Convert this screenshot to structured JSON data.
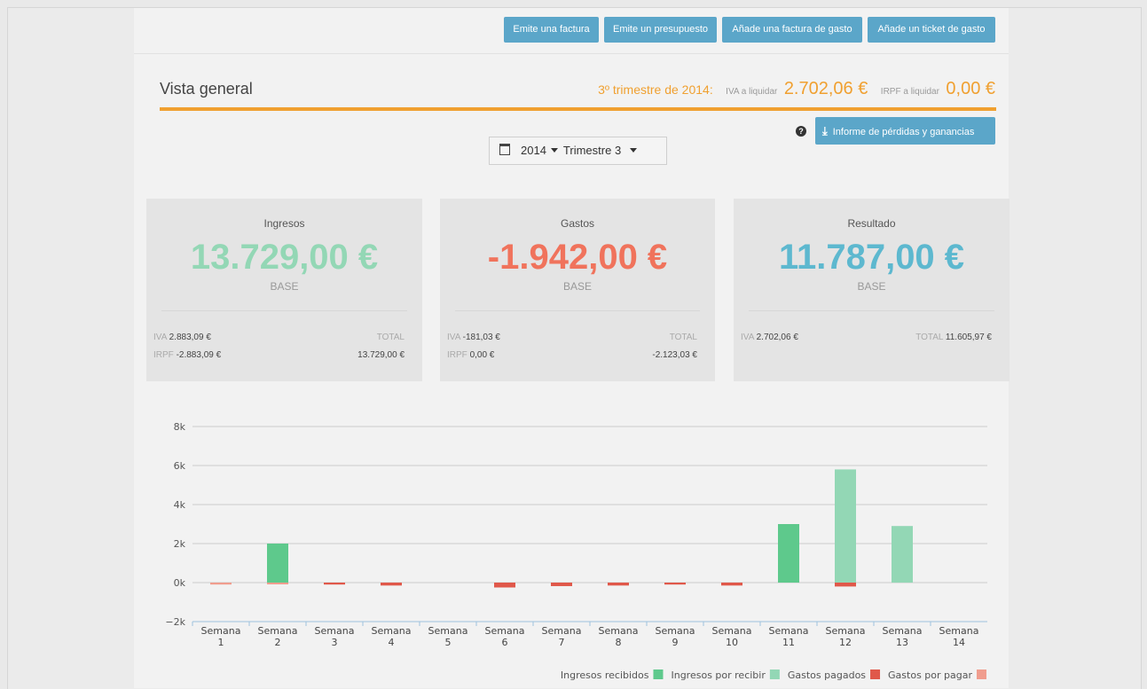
{
  "toolbar": {
    "buttons": [
      {
        "label": "Emite una factura"
      },
      {
        "label": "Emite un presupuesto"
      },
      {
        "label": "Añade una factura de gasto"
      },
      {
        "label": "Añade un ticket de gasto"
      }
    ]
  },
  "header": {
    "title": "Vista general",
    "quarter_text": "3º trimestre de 2014:",
    "iva_label": "IVA a liquidar",
    "iva_value": "2.702,06 €",
    "irpf_label": "IRPF a liquidar",
    "irpf_value": "0,00 €"
  },
  "report_button": {
    "label": "Informe de pérdidas y ganancias",
    "icon": "download-icon"
  },
  "help_icon": "?",
  "period_selector": {
    "year": "2014",
    "quarter": "Trimestre 3"
  },
  "cards": {
    "ingresos": {
      "label": "Ingresos",
      "amount": "13.729,00 €",
      "base": "BASE",
      "iva_key": "IVA",
      "iva": "2.883,09 €",
      "irpf_key": "IRPF",
      "irpf": "-2.883,09 €",
      "total_key": "TOTAL",
      "total": "13.729,00 €"
    },
    "gastos": {
      "label": "Gastos",
      "amount": "-1.942,00 €",
      "base": "BASE",
      "iva_key": "IVA",
      "iva": "-181,03 €",
      "irpf_key": "IRPF",
      "irpf": "0,00 €",
      "total_key": "TOTAL",
      "total": "-2.123,03 €"
    },
    "resultado": {
      "label": "Resultado",
      "amount": "11.787,00 €",
      "base": "BASE",
      "iva_key": "IVA",
      "iva": "2.702,06 €",
      "total_key": "TOTAL",
      "total": "11.605,97 €"
    }
  },
  "colors": {
    "green": "#93d7b5",
    "red": "#f0735c",
    "blue": "#5db8cf",
    "accent": "#f0a030",
    "button": "#5ba6c9"
  },
  "chart_data": {
    "type": "bar",
    "categories": [
      [
        "Semana",
        "1"
      ],
      [
        "Semana",
        "2"
      ],
      [
        "Semana",
        "3"
      ],
      [
        "Semana",
        "4"
      ],
      [
        "Semana",
        "5"
      ],
      [
        "Semana",
        "6"
      ],
      [
        "Semana",
        "7"
      ],
      [
        "Semana",
        "8"
      ],
      [
        "Semana",
        "9"
      ],
      [
        "Semana",
        "10"
      ],
      [
        "Semana",
        "11"
      ],
      [
        "Semana",
        "12"
      ],
      [
        "Semana",
        "13"
      ],
      [
        "Semana",
        "14"
      ]
    ],
    "ylim": [
      -2000,
      8000
    ],
    "yticks": [
      -2000,
      0,
      2000,
      4000,
      6000,
      8000
    ],
    "ytick_labels": [
      "−2k",
      "0k",
      "2k",
      "4k",
      "6k",
      "8k"
    ],
    "grid": true,
    "legend_position": "bottom-right",
    "series": [
      {
        "name": "Ingresos recibidos",
        "color": "#5ec98c",
        "values": [
          0,
          2000,
          0,
          0,
          0,
          0,
          0,
          0,
          0,
          0,
          3000,
          0,
          0,
          0
        ]
      },
      {
        "name": "Ingresos por recibir",
        "color": "#93d7b5",
        "values": [
          0,
          0,
          0,
          0,
          0,
          0,
          0,
          0,
          0,
          0,
          0,
          5800,
          2900,
          0
        ]
      },
      {
        "name": "Gastos pagados",
        "color": "#e0584a",
        "values": [
          0,
          0,
          -100,
          -150,
          0,
          -250,
          -180,
          -150,
          -100,
          -150,
          0,
          -200,
          0,
          0
        ]
      },
      {
        "name": "Gastos por pagar",
        "color": "#f09d8e",
        "values": [
          -100,
          -80,
          0,
          0,
          0,
          0,
          0,
          0,
          0,
          0,
          0,
          0,
          0,
          0
        ]
      }
    ]
  }
}
